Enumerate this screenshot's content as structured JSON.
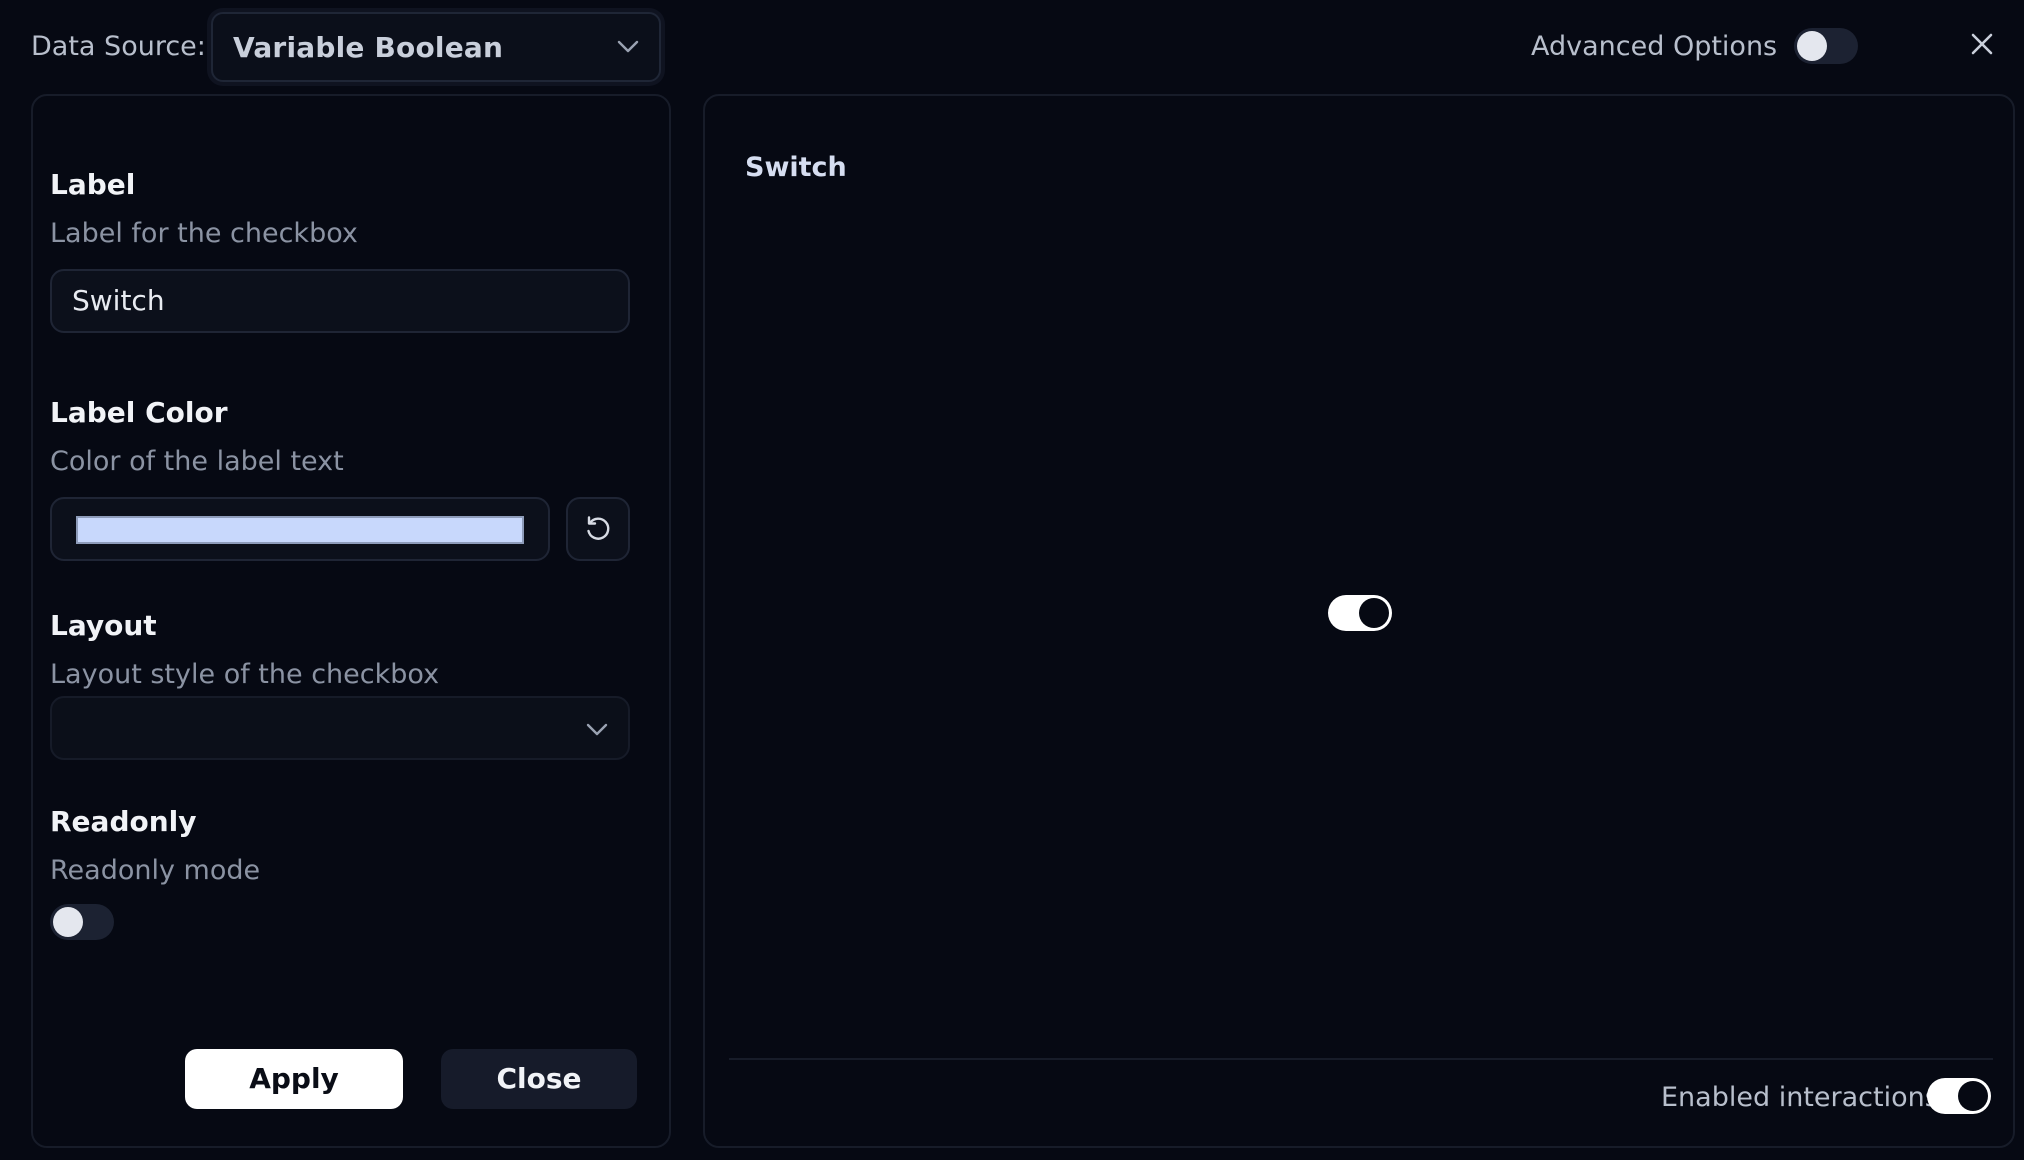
{
  "header": {
    "data_source_label": "Data Source:",
    "data_source_value": "Variable Boolean",
    "advanced_options_label": "Advanced Options",
    "advanced_options_on": false
  },
  "form": {
    "label": {
      "title": "Label",
      "description": "Label for the checkbox",
      "value": "Switch"
    },
    "label_color": {
      "title": "Label Color",
      "description": "Color of the label text",
      "value": "#c8d8fc"
    },
    "layout": {
      "title": "Layout",
      "description": "Layout style of the checkbox",
      "value": ""
    },
    "readonly": {
      "title": "Readonly",
      "description": "Readonly mode",
      "value": false
    },
    "apply_label": "Apply",
    "close_label": "Close"
  },
  "preview": {
    "label": "Switch",
    "switch_on": true,
    "enabled_interactions_label": "Enabled interactions",
    "enabled_interactions_on": true
  },
  "icons": {
    "dropdown": "chevron-down-icon",
    "close": "close-icon",
    "reset": "reset-icon"
  }
}
